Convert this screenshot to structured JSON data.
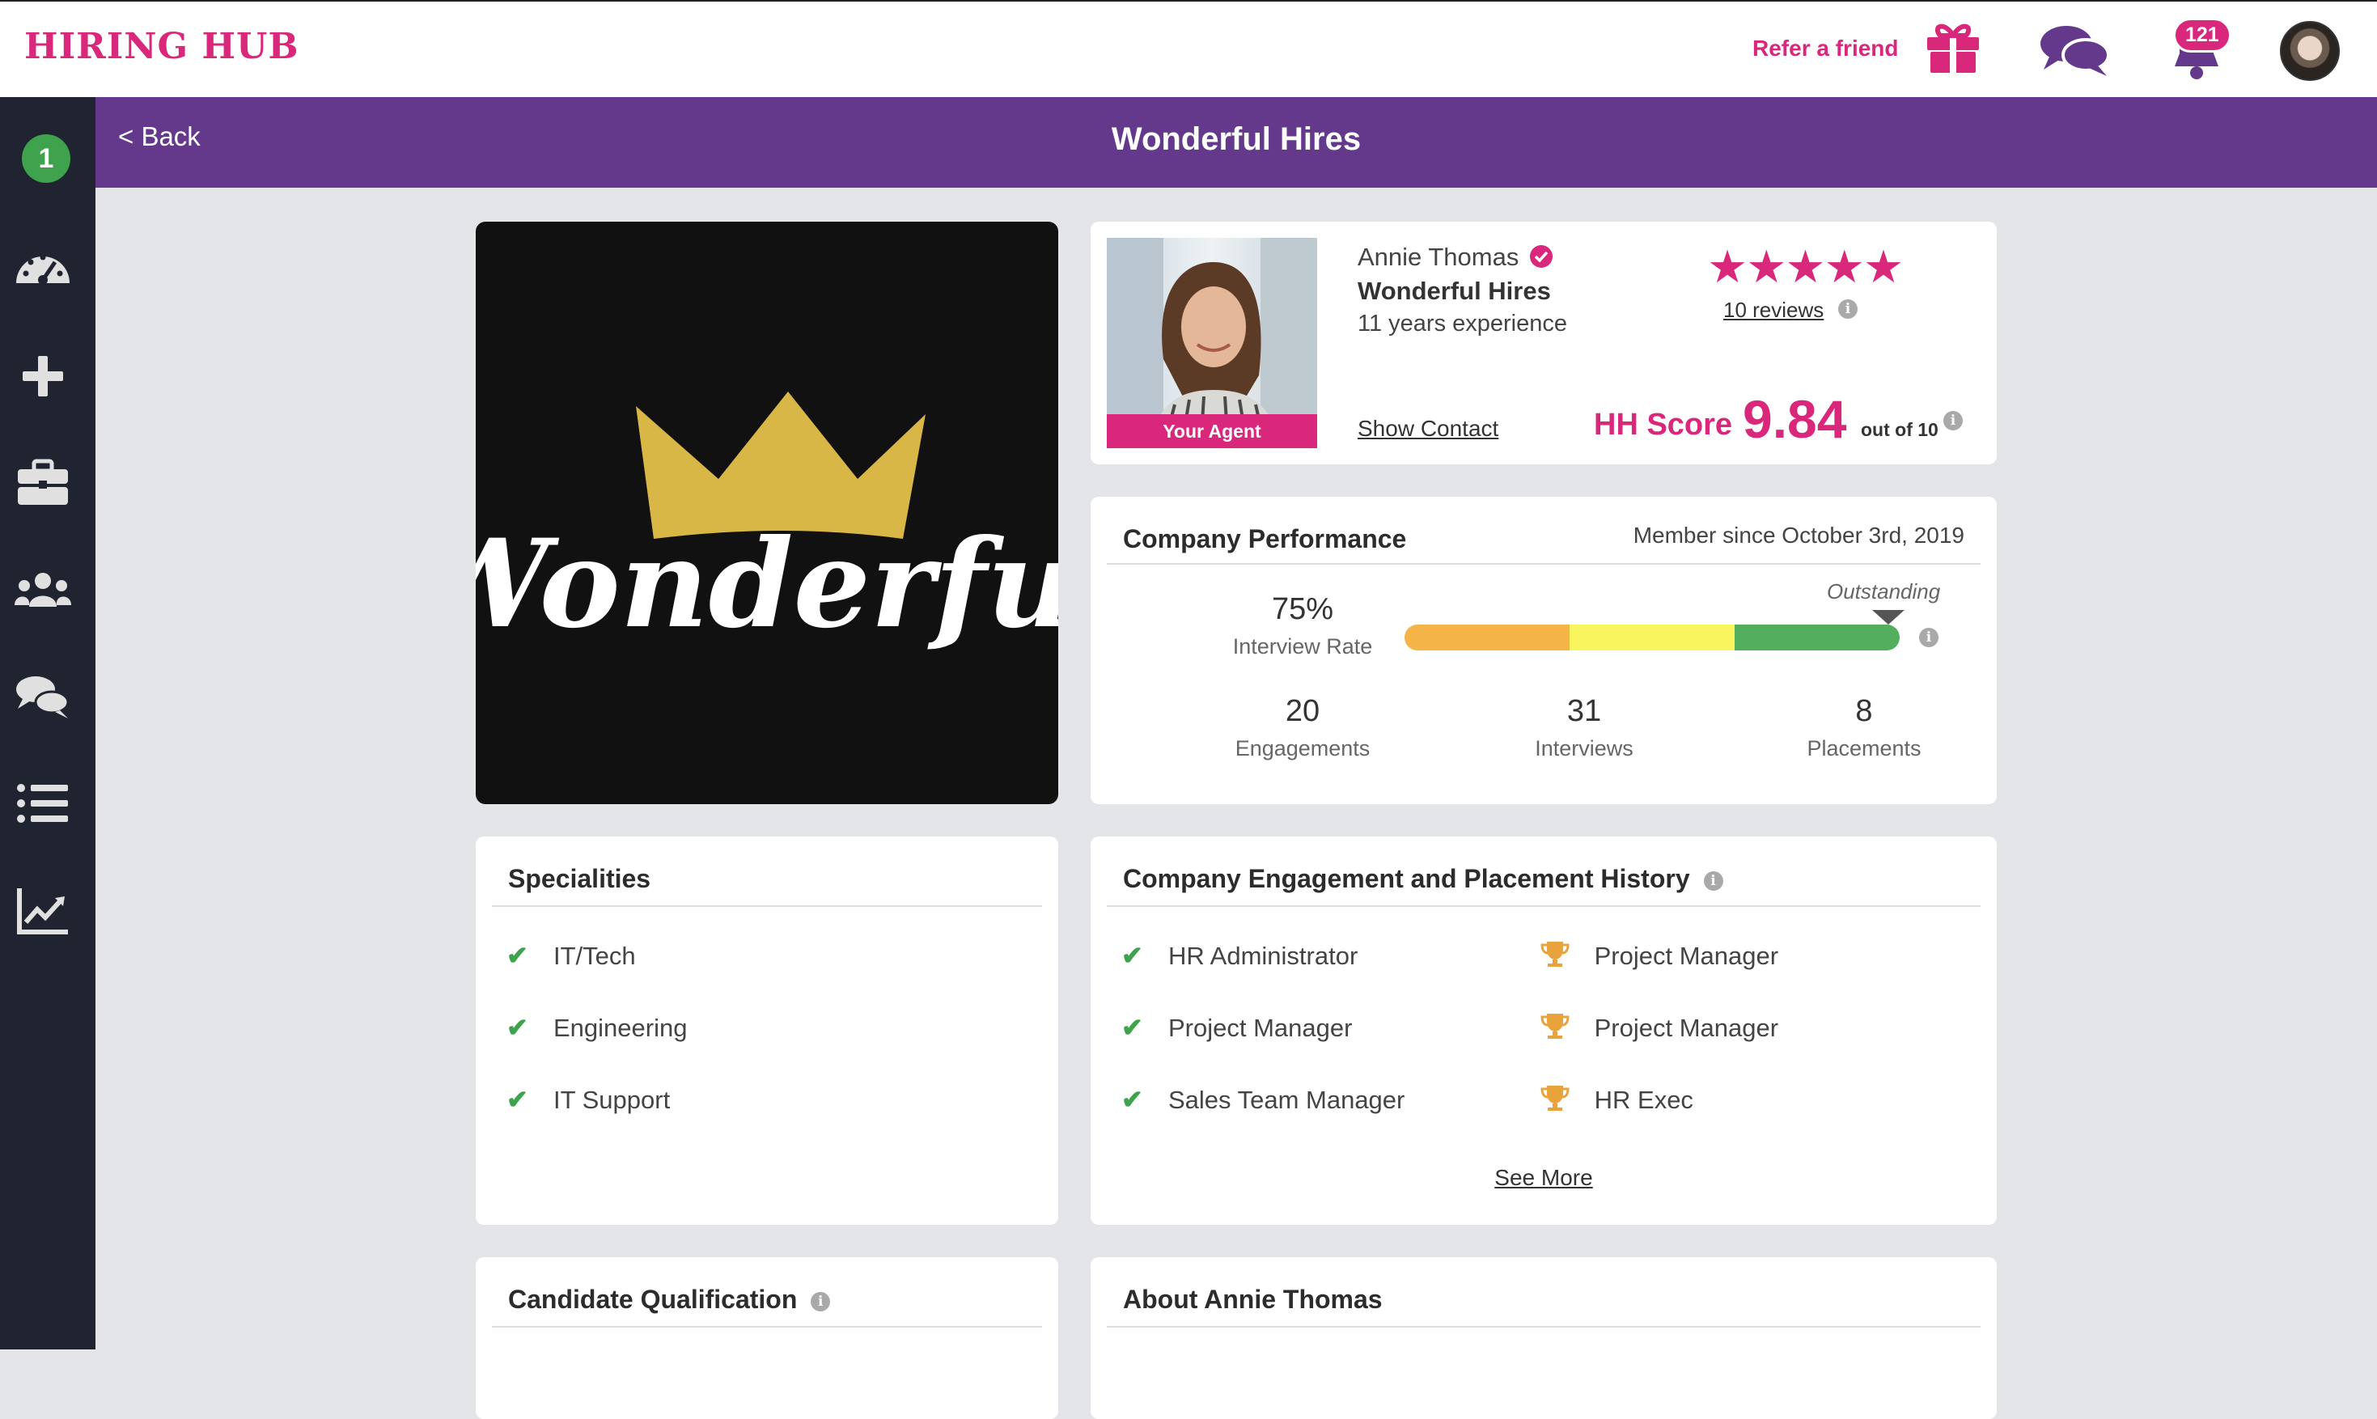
{
  "app": {
    "logo": "HIRING HUB",
    "refer_label": "Refer a friend",
    "notification_count": "121"
  },
  "sidebar": {
    "badge": "1",
    "items": [
      "dashboard",
      "add",
      "jobs",
      "candidates",
      "messages",
      "lists",
      "reports"
    ]
  },
  "header": {
    "back_label": "< Back",
    "title": "Wonderful Hires"
  },
  "agent": {
    "name": "Annie Thomas",
    "company": "Wonderful Hires",
    "experience": "11 years experience",
    "photo_label": "Your Agent",
    "show_contact": "Show Contact",
    "rating": 5,
    "stars": "★★★★★",
    "reviews": "10 reviews",
    "score_label": "HH Score",
    "score_value": "9.84",
    "score_out_of": "out of 10"
  },
  "logo_card": {
    "wordmark": "Wonderful"
  },
  "performance": {
    "title": "Company Performance",
    "member_since": "Member since October 3rd, 2019",
    "interview_rate": "75%",
    "interview_rate_label": "Interview Rate",
    "rating_label": "Outstanding",
    "bar_colors": [
      "#f5b447",
      "#f9f55f",
      "#53ae5e"
    ],
    "stats": [
      {
        "value": "20",
        "label": "Engagements"
      },
      {
        "value": "31",
        "label": "Interviews"
      },
      {
        "value": "8",
        "label": "Placements"
      }
    ]
  },
  "specialities": {
    "title": "Specialities",
    "items": [
      "IT/Tech",
      "Engineering",
      "IT Support"
    ]
  },
  "history": {
    "title": "Company Engagement and Placement History",
    "engagements": [
      "HR Administrator",
      "Project Manager",
      "Sales Team Manager"
    ],
    "placements": [
      "Project Manager",
      "Project Manager",
      "HR Exec"
    ],
    "see_more": "See More"
  },
  "qualification": {
    "title": "Candidate Qualification"
  },
  "about": {
    "title": "About Annie Thomas"
  },
  "colors": {
    "brand_pink": "#d9277b",
    "brand_purple": "#64388b",
    "sidebar": "#1f2430",
    "success_green": "#3fa24d",
    "trophy_gold": "#e8a33d"
  }
}
